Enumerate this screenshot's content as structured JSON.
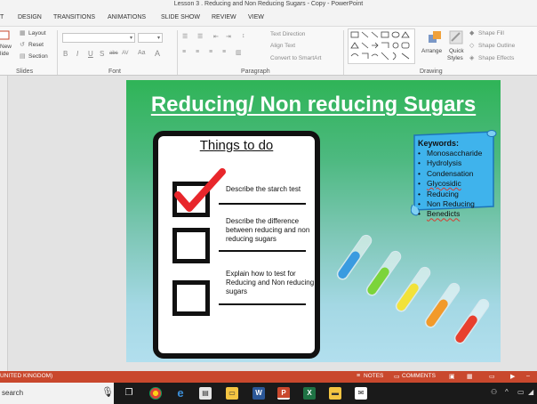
{
  "window": {
    "title": "Lesson 3 . Reducing and Non Reducing Sugars - Copy - PowerPoint"
  },
  "ribbon": {
    "tabs": [
      "T",
      "DESIGN",
      "TRANSITIONS",
      "ANIMATIONS",
      "SLIDE SHOW",
      "REVIEW",
      "VIEW"
    ],
    "slides_group": {
      "new_label_1": "New",
      "new_label_2": "lide",
      "layout": "Layout",
      "reset": "Reset",
      "section": "Section",
      "label": "Slides"
    },
    "font_group": {
      "bold": "B",
      "italic": "I",
      "underline": "U",
      "strike": "S",
      "spacing": "abc",
      "spacing2": "AV",
      "case": "Aa",
      "label": "Font"
    },
    "paragraph_group": {
      "text_direction": "Text Direction",
      "align_text": "Align Text",
      "smartart": "Convert to SmartArt",
      "label": "Paragraph"
    },
    "drawing_group": {
      "arrange": "Arrange",
      "quick_styles_1": "Quick",
      "quick_styles_2": "Styles",
      "shape_fill": "Shape Fill",
      "shape_outline": "Shape Outline",
      "shape_effects": "Shape Effects",
      "label": "Drawing"
    }
  },
  "slide": {
    "title": "Reducing/ Non reducing  Sugars",
    "things_heading": "Things to do",
    "tasks": [
      {
        "text": "Describe the starch test",
        "checked": true
      },
      {
        "text": "Describe the difference between reducing and non reducing sugars",
        "checked": false
      },
      {
        "text": "Explain how to test for Reducing and Non reducing sugars",
        "checked": false
      }
    ],
    "keywords_title": "Keywords:",
    "keywords": [
      "Monosaccharide",
      "Hydrolysis",
      "Condensation",
      "Glycosidic",
      "Reducing",
      "Non Reducing",
      "Benedicts"
    ],
    "tube_colors": [
      "#3a9be0",
      "#7cd43a",
      "#f2e23a",
      "#f29a2a",
      "#e8402e"
    ]
  },
  "status": {
    "language": "UNITED KINGDOM)",
    "notes": "NOTES",
    "comments": "COMMENTS"
  },
  "taskbar": {
    "search": "search"
  }
}
